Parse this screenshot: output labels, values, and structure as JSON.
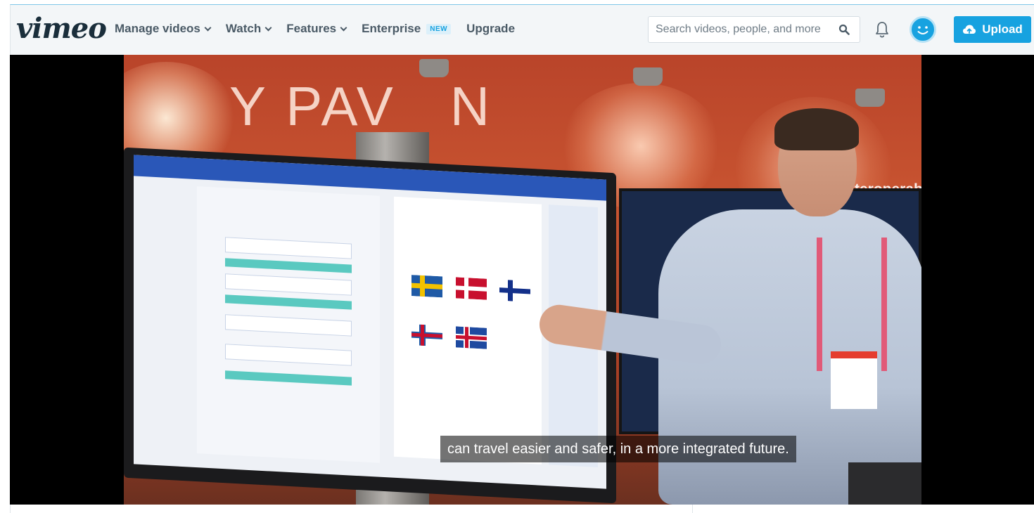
{
  "brand": {
    "logo_text": "vimeo"
  },
  "nav": {
    "items": [
      {
        "label": "Manage videos",
        "has_dropdown": true
      },
      {
        "label": "Watch",
        "has_dropdown": true
      },
      {
        "label": "Features",
        "has_dropdown": true
      },
      {
        "label": "Enterprise",
        "has_dropdown": false,
        "badge": "NEW"
      },
      {
        "label": "Upgrade",
        "has_dropdown": false
      }
    ]
  },
  "search": {
    "placeholder": "Search videos, people, and more",
    "value": "",
    "icon": "search-icon"
  },
  "header_actions": {
    "notifications_icon": "bell-icon",
    "avatar_icon": "smiley-avatar-icon",
    "upload_label": "Upload",
    "upload_icon": "cloud-upload-icon"
  },
  "video": {
    "caption": "can travel easier and safer, in a more integrated future."
  },
  "colors": {
    "accent": "#17a2e0",
    "nav_text": "#4a5a66",
    "logo": "#1a2e3b",
    "topbar_bg": "#f3f6f8"
  }
}
